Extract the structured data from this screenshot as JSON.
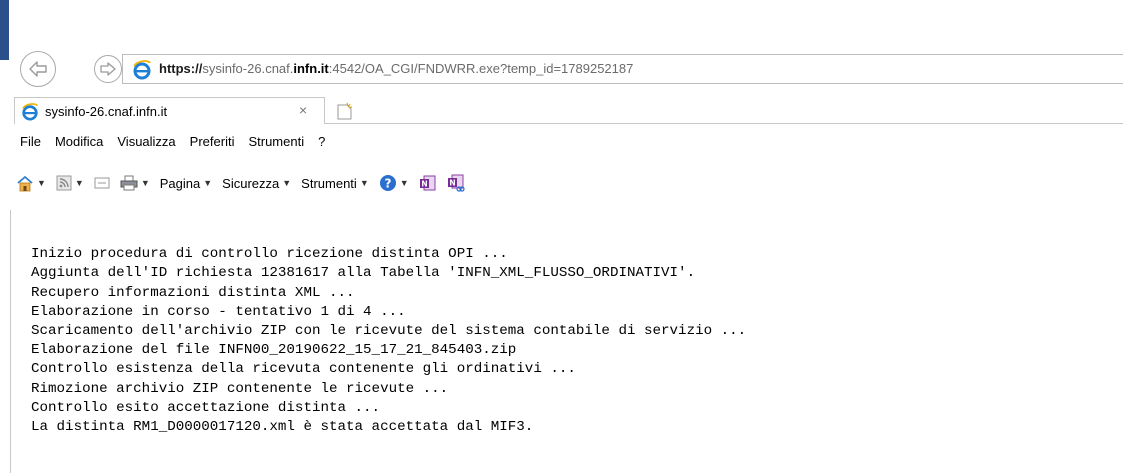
{
  "address_bar": {
    "url_scheme": "https://",
    "url_sub": "sysinfo-26.cnaf.",
    "url_domain": "infn.it",
    "url_rest": ":4542/OA_CGI/FNDWRR.exe?temp_id=1789252187"
  },
  "tab": {
    "title": "sysinfo-26.cnaf.infn.it",
    "close_glyph": "×"
  },
  "menu": [
    "File",
    "Modifica",
    "Visualizza",
    "Preferiti",
    "Strumenti",
    "?"
  ],
  "command_bar": {
    "pagina": "Pagina",
    "sicurezza": "Sicurezza",
    "strumenti": "Strumenti"
  },
  "content_lines": [
    "Inizio procedura di controllo ricezione distinta OPI ...",
    "Aggiunta dell'ID richiesta 12381617 alla Tabella 'INFN_XML_FLUSSO_ORDINATIVI'.",
    "Recupero informazioni distinta XML ...",
    "Elaborazione in corso - tentativo 1 di 4 ...",
    "Scaricamento dell'archivio ZIP con le ricevute del sistema contabile di servizio ...",
    "Elaborazione del file INFN00_20190622_15_17_21_845403.zip",
    "Controllo esistenza della ricevuta contenente gli ordinativi ...",
    "Rimozione archivio ZIP contenente le ricevute ...",
    "Controllo esito accettazione distinta ...",
    "La distinta RM1_D0000017120.xml è stata accettata dal MIF3."
  ],
  "icons": {
    "back": "back-arrow-icon",
    "forward": "forward-arrow-icon",
    "ie": "internet-explorer-icon",
    "home": "home-icon",
    "feeds": "rss-feed-icon",
    "mail": "mail-icon",
    "print": "printer-icon",
    "help": "help-icon",
    "onenote": "onenote-icon",
    "onenote_linked": "onenote-linked-icon",
    "new_tab": "new-tab-icon"
  },
  "colors": {
    "ie_blue": "#1e7fd6",
    "left_strip": "#2b4f8a"
  }
}
